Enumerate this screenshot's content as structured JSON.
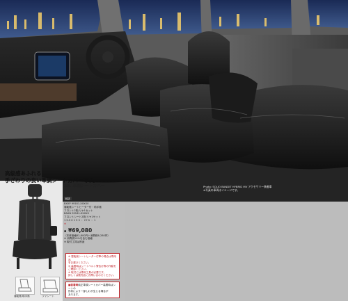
{
  "headline": {
    "line1": "高級感あふれる",
    "line2": "手ざわりの良い革調シートカバーです。"
  },
  "photo_credit": {
    "line1": "Photo: SOLIO BANDIT HYBRID MV アクセサリー装着車",
    "line2": "※写真の車両はイメージです。"
  },
  "product": {
    "number": "28.",
    "name": "革調シートカバー",
    "badge": "純正",
    "spec_lines": [
      "BXXP 99181-XXXX0",
      "運転席シートヒーター付・助手席",
      "フロント2枚/リヤ1セット",
      "BAXN 99181-XXXX0",
      "フロントシート2枚/リヤ1セット",
      "1 5.5 0 1 9 5 ・ Y.7.5 ・ 1"
    ],
    "spec_line_red": "※",
    "price": "¥69,080",
    "price_label_prefix": "a",
    "price_note": "（本体価格62,800円＋消費税6,280円）",
    "footnotes": [
      "※ 消費税10%を含む価格",
      "※ 取付工賃は別途"
    ]
  },
  "notice_red": [
    "※ 運転席シートヒーター付車の場合は専用品",
    "をお選びください。",
    "※ 装着時はシートベルト警告灯等の作動を",
    "ご確認ください。",
    "※ 取付には専用工具が必要です。",
    "詳しくは販売店にお問い合わせください。"
  ],
  "notice_bottom": {
    "tag": "■装着時",
    "lines": [
      "純正革調シートカバー装着時はシートの",
      "形状により一部しわが生じる場合が",
      "あります。"
    ]
  },
  "thumb_captions": [
    "運転席/助手席",
    "リヤシート"
  ]
}
